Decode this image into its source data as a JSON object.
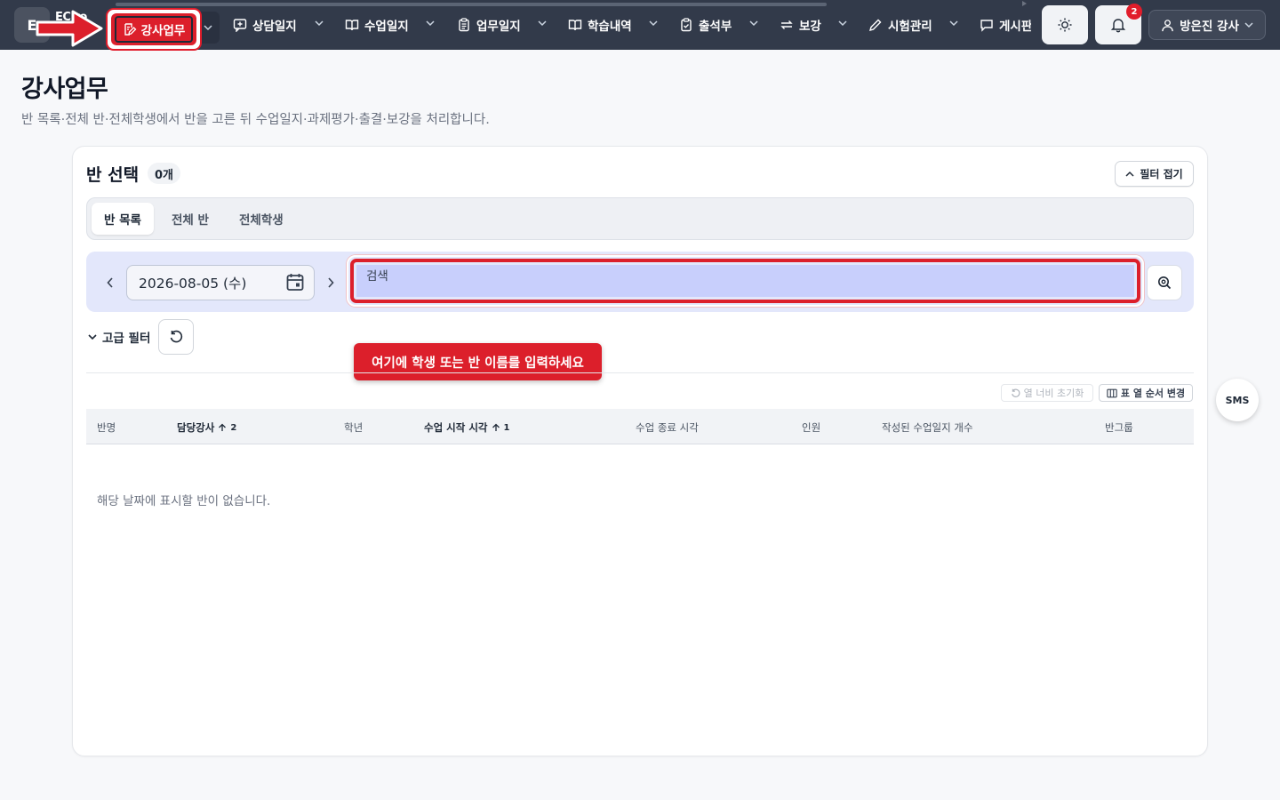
{
  "nav": {
    "logo_letter": "E",
    "logo_text": "EC  ro",
    "active_label": "강사업무",
    "items": [
      {
        "label": "상담일지"
      },
      {
        "label": "수업일지"
      },
      {
        "label": "업무일지"
      },
      {
        "label": "학습내역"
      },
      {
        "label": "출석부"
      },
      {
        "label": "보강"
      },
      {
        "label": "시험관리"
      },
      {
        "label": "게시판"
      }
    ],
    "notification_count": "2",
    "user_label": "방은진 강사"
  },
  "page": {
    "title": "강사업무",
    "description": "반 목록·전체 반·전체학생에서 반을 고른 뒤 수업일지·과제평가·출결·보강을 처리합니다."
  },
  "card": {
    "title": "반 선택",
    "count": "0개",
    "collapse_label": "필터 접기",
    "tabs": [
      {
        "label": "반 목록",
        "active": true
      },
      {
        "label": "전체 반",
        "active": false
      },
      {
        "label": "전체학생",
        "active": false
      }
    ],
    "date_value": "2026-08-05 (수)",
    "search_placeholder": "검색",
    "advanced_filter_label": "고급 필터",
    "tooltip": "여기에 학생 또는 반 이름를 입력하세요",
    "col_reset_label": "열 너비 초기화",
    "col_order_label": "표 열 순서 변경",
    "columns": [
      {
        "label": "반명",
        "sort": ""
      },
      {
        "label": "담당강사",
        "sort": "2"
      },
      {
        "label": "학년",
        "sort": ""
      },
      {
        "label": "수업 시작 시각",
        "sort": "1"
      },
      {
        "label": "수업 종료 시각",
        "sort": ""
      },
      {
        "label": "인원",
        "sort": ""
      },
      {
        "label": "작성된 수업일지 개수",
        "sort": ""
      },
      {
        "label": "반그룹",
        "sort": ""
      }
    ],
    "empty_message": "해당 날짜에 표시할 반이 없습니다."
  },
  "sms_label": "SMS",
  "colors": {
    "nav_bg": "#323a4a",
    "accent_red": "#dc1f2b",
    "filter_bar_bg": "#e3e7fb",
    "search_bg": "#c8cffc"
  }
}
